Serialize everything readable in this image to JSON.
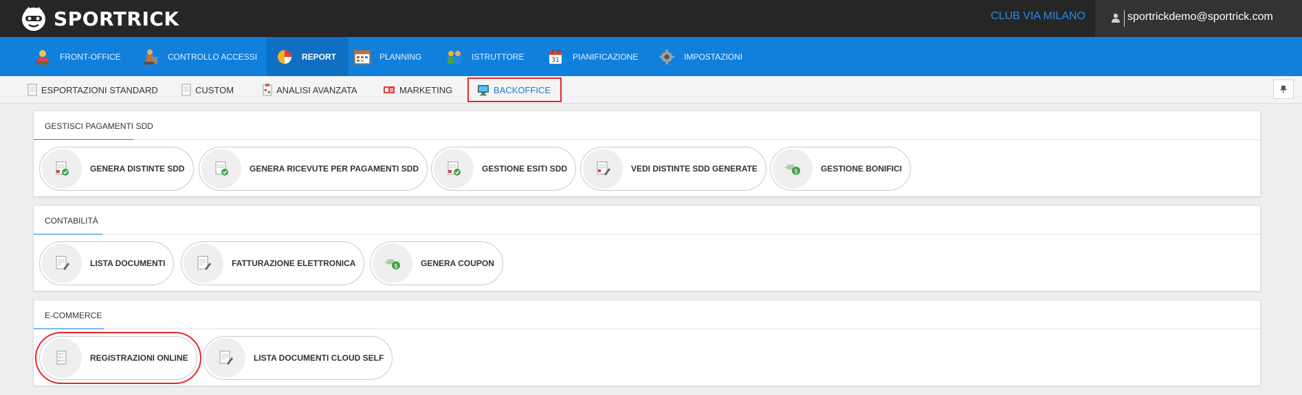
{
  "brand": {
    "name": "SPORTRICK"
  },
  "header": {
    "club": "CLUB VIA MILANO",
    "user_email": "sportrickdemo@sportrick.com"
  },
  "main_nav": [
    {
      "label": "FRONT-OFFICE",
      "icon": "receptionist-icon"
    },
    {
      "label": "CONTROLLO ACCESSI",
      "icon": "turnstile-icon"
    },
    {
      "label": "REPORT",
      "icon": "pie-chart-icon",
      "active": true
    },
    {
      "label": "PLANNING",
      "icon": "calendar-grid-icon"
    },
    {
      "label": "ISTRUTTORE",
      "icon": "instructor-icon"
    },
    {
      "label": "PIANIFICAZIONE",
      "icon": "calendar-icon"
    },
    {
      "label": "IMPOSTAZIONI",
      "icon": "gear-icon"
    }
  ],
  "sub_nav": [
    {
      "label": "ESPORTAZIONI STANDARD",
      "icon": "document-icon"
    },
    {
      "label": "CUSTOM",
      "icon": "document-icon"
    },
    {
      "label": "ANALISI AVANZATA",
      "icon": "clipboard-icon"
    },
    {
      "label": "MARKETING",
      "icon": "megaphone-icon"
    },
    {
      "label": "BACKOFFICE",
      "icon": "monitor-icon",
      "active": true
    }
  ],
  "sections": [
    {
      "title": "GESTISCI PAGAMENTI SDD",
      "items": [
        {
          "label": "GENERA DISTINTE SDD",
          "icon": "document-check-icon"
        },
        {
          "label": "GENERA RICEVUTE PER PAGAMENTI SDD",
          "icon": "document-check-icon"
        },
        {
          "label": "GESTIONE ESITI SDD",
          "icon": "document-check-icon"
        },
        {
          "label": "VEDI DISTINTE SDD GENERATE",
          "icon": "document-pen-icon"
        },
        {
          "label": "GESTIONE BONIFICI",
          "icon": "money-hand-icon"
        }
      ]
    },
    {
      "title": "CONTABILITÀ",
      "items": [
        {
          "label": "LISTA DOCUMENTI",
          "icon": "document-pen-icon"
        },
        {
          "label": "FATTURAZIONE ELETTRONICA",
          "icon": "document-pen-icon"
        },
        {
          "label": "GENERA COUPON",
          "icon": "money-hand-icon"
        }
      ]
    },
    {
      "title": "E-COMMERCE",
      "items": [
        {
          "label": "REGISTRAZIONI ONLINE",
          "icon": "form-icon"
        },
        {
          "label": "LISTA DOCUMENTI CLOUD SELF",
          "icon": "document-pen-icon"
        }
      ]
    }
  ],
  "colors": {
    "accent": "#1180dd",
    "topbar": "#262626",
    "highlight": "#e5252b",
    "club": "#2a8be8"
  }
}
